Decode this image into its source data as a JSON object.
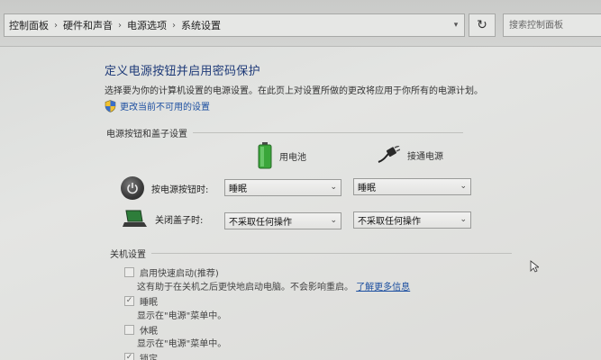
{
  "breadcrumbs": [
    "控制面板",
    "硬件和声音",
    "电源选项",
    "系统设置"
  ],
  "search": {
    "placeholder": "搜索控制面板"
  },
  "page": {
    "title": "定义电源按钮并启用密码保护",
    "description": "选择要为你的计算机设置的电源设置。在此页上对设置所做的更改将应用于你所有的电源计划。",
    "change_link": "更改当前不可用的设置"
  },
  "power_section": {
    "header": "电源按钮和盖子设置",
    "columns": {
      "battery": "用电池",
      "plugged": "接通电源"
    },
    "rows": [
      {
        "label": "按电源按钮时:",
        "battery": "睡眠",
        "plugged": "睡眠"
      },
      {
        "label": "关闭盖子时:",
        "battery": "不采取任何操作",
        "plugged": "不采取任何操作"
      }
    ]
  },
  "shutdown_section": {
    "header": "关机设置",
    "fast_startup": {
      "label": "启用快速启动(推荐)",
      "note": "这有助于在关机之后更快地启动电脑。不会影响重启。",
      "link": "了解更多信息",
      "checked": false
    },
    "sleep": {
      "label": "睡眠",
      "note": "显示在\"电源\"菜单中。",
      "checked": true
    },
    "hibernate": {
      "label": "休眠",
      "note": "显示在\"电源\"菜单中。",
      "checked": false
    },
    "lock": {
      "label": "锁定",
      "checked": true
    }
  },
  "colors": {
    "title": "#1e3a78",
    "link": "#1c4fa0",
    "battery_green": "#3aa63a"
  }
}
